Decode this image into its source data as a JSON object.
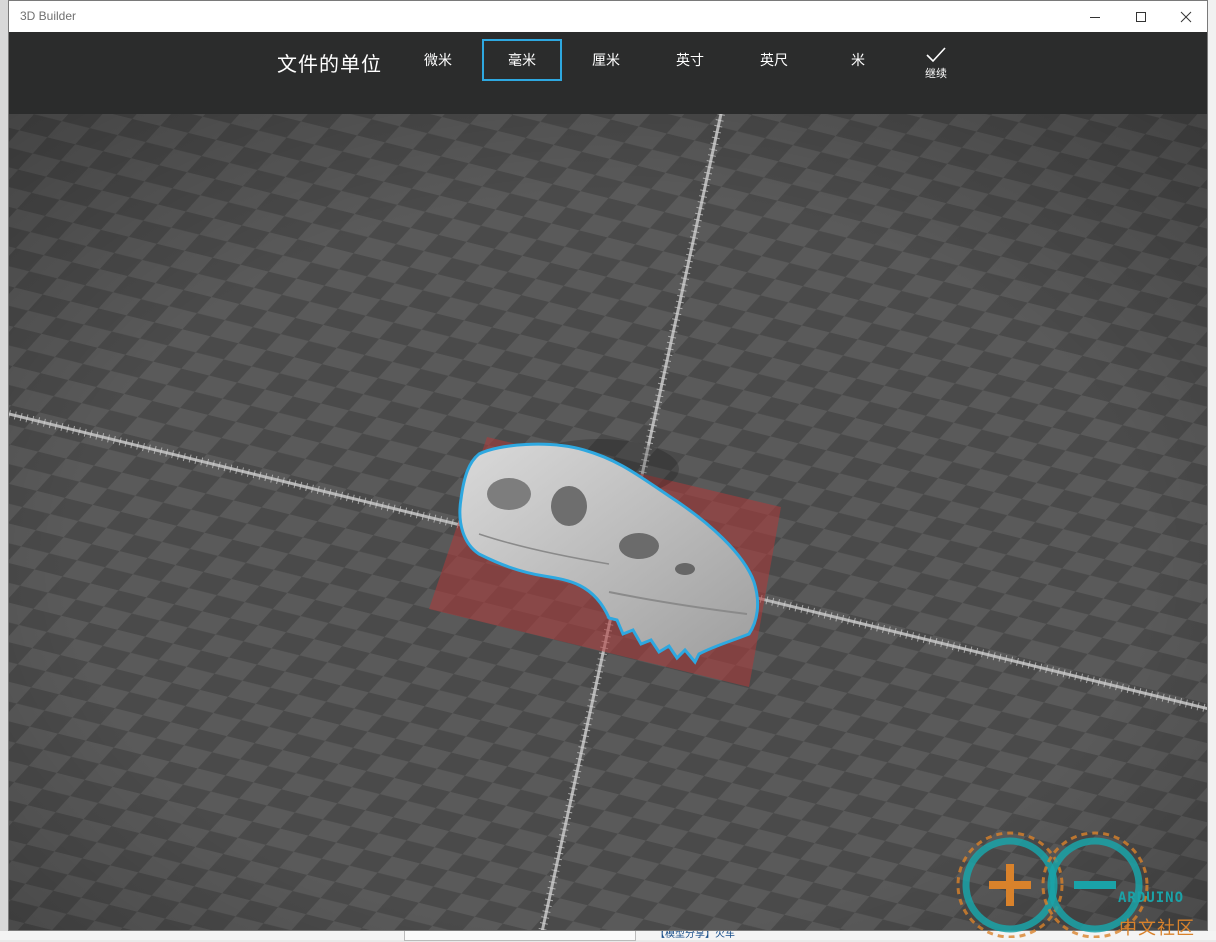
{
  "window": {
    "title": "3D Builder"
  },
  "window_controls": {
    "minimize_icon": "minimize-icon",
    "maximize_icon": "maximize-icon",
    "close_icon": "close-icon"
  },
  "unit_bar": {
    "title": "文件的单位",
    "options": [
      {
        "label": "微米",
        "selected": false
      },
      {
        "label": "毫米",
        "selected": true
      },
      {
        "label": "厘米",
        "selected": false
      },
      {
        "label": "英寸",
        "selected": false
      },
      {
        "label": "英尺",
        "selected": false
      },
      {
        "label": "米",
        "selected": false
      }
    ],
    "continue_label": "继续",
    "continue_icon": "checkmark-icon",
    "accent_color": "#2ea8e0"
  },
  "viewport": {
    "model": "dinosaur-skull",
    "selection_color": "#2ea8e0",
    "footprint_color": "#b03a3a"
  },
  "watermark": {
    "wordmark": "ARDUINO",
    "chinese": "中文社区"
  },
  "background": {
    "link_text": "【模型分享】火车"
  }
}
